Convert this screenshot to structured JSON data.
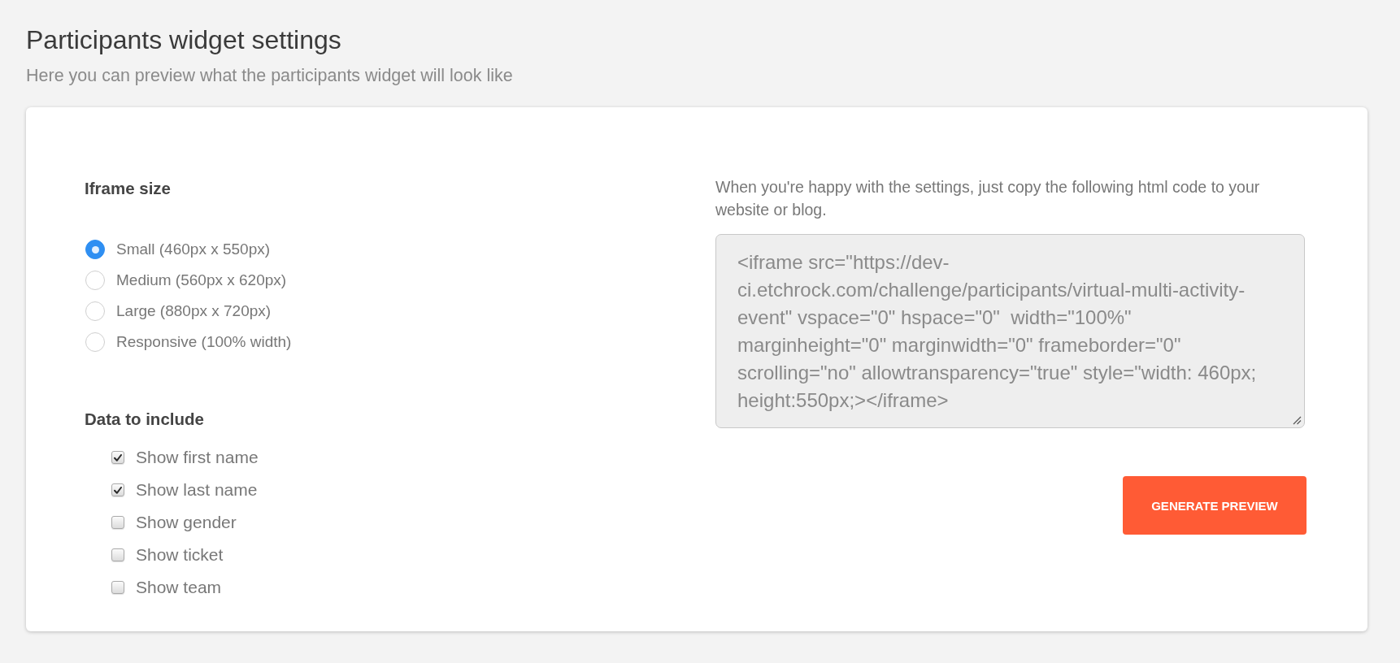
{
  "page": {
    "title": "Participants widget settings",
    "subtitle": "Here you can preview what the participants widget will look like"
  },
  "iframe_size": {
    "label": "Iframe size",
    "options": [
      {
        "label": "Small (460px x 550px)",
        "selected": true
      },
      {
        "label": "Medium (560px x 620px)",
        "selected": false
      },
      {
        "label": "Large (880px x 720px)",
        "selected": false
      },
      {
        "label": "Responsive (100% width)",
        "selected": false
      }
    ]
  },
  "data_to_include": {
    "label": "Data to include",
    "items": [
      {
        "label": "Show first name",
        "checked": true
      },
      {
        "label": "Show last name",
        "checked": true
      },
      {
        "label": "Show gender",
        "checked": false
      },
      {
        "label": "Show ticket",
        "checked": false
      },
      {
        "label": "Show team",
        "checked": false
      }
    ]
  },
  "embed": {
    "instructions": "When you're happy with the settings, just copy the following html code to your website or blog.",
    "code": "<iframe src=\"https://dev-ci.etchrock.com/challenge/participants/virtual-multi-activity-event\" vspace=\"0\" hspace=\"0\"  width=\"100%\" marginheight=\"0\" marginwidth=\"0\" frameborder=\"0\" scrolling=\"no\" allowtransparency=\"true\" style=\"width: 460px; height:550px;></iframe>"
  },
  "buttons": [
    {
      "label": "GENERATE PREVIEW"
    }
  ]
}
